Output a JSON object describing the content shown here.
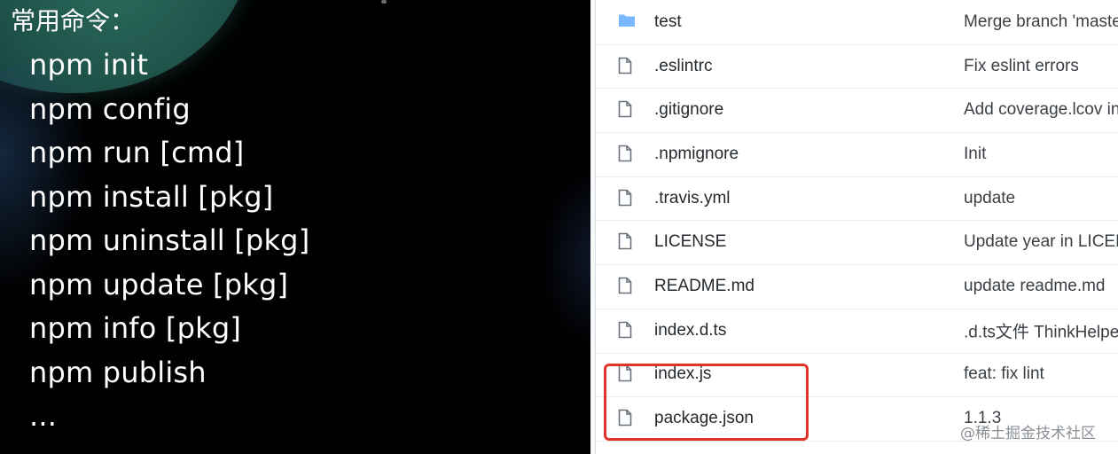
{
  "slide": {
    "title": "常用命令：",
    "commands": [
      "npm init",
      "npm config",
      "npm run [cmd]",
      "npm install [pkg]",
      "npm uninstall [pkg]",
      "npm update [pkg]",
      "npm info [pkg]",
      "npm publish",
      "..."
    ]
  },
  "repo": {
    "rows": [
      {
        "type": "folder",
        "name": "test",
        "message": "Merge branch 'master"
      },
      {
        "type": "file",
        "name": ".eslintrc",
        "message": "Fix eslint errors"
      },
      {
        "type": "file",
        "name": ".gitignore",
        "message": "Add coverage.lcov in"
      },
      {
        "type": "file",
        "name": ".npmignore",
        "message": "Init"
      },
      {
        "type": "file",
        "name": ".travis.yml",
        "message": "update"
      },
      {
        "type": "file",
        "name": "LICENSE",
        "message": "Update year in LICEN"
      },
      {
        "type": "file",
        "name": "README.md",
        "message": "update readme.md"
      },
      {
        "type": "file",
        "name": "index.d.ts",
        "message": ".d.ts文件 ThinkHelpe"
      },
      {
        "type": "file",
        "name": "index.js",
        "message": "feat: fix lint"
      },
      {
        "type": "file",
        "name": "package.json",
        "message": "1.1.3"
      }
    ],
    "highlighted_files": [
      "index.js",
      "package.json"
    ],
    "highlight_color": "#e0342a",
    "folder_icon_color": "#79b8ff",
    "file_icon_color": "#6a737d"
  },
  "watermark": "@稀土掘金技术社区"
}
